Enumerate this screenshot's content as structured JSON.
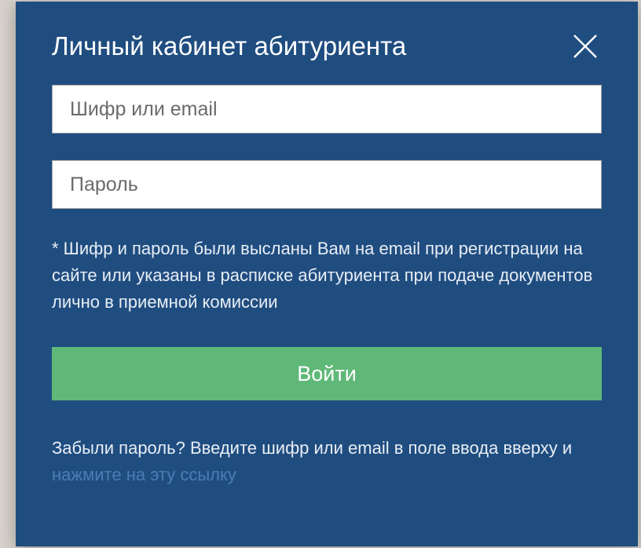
{
  "modal": {
    "title": "Личный кабинет абитуриента",
    "login_input": {
      "placeholder": "Шифр или email",
      "value": ""
    },
    "password_input": {
      "placeholder": "Пароль",
      "value": ""
    },
    "help_text": "* Шифр и пароль были высланы Вам на email при регистрации на сайте или указаны в расписке абитуриента при подаче документов лично в приемной комиссии",
    "login_button": "Войти",
    "forgot_prefix": "Забыли пароль? Введите шифр или email в поле ввода вверху и ",
    "forgot_link": "нажмите на эту ссылку"
  }
}
